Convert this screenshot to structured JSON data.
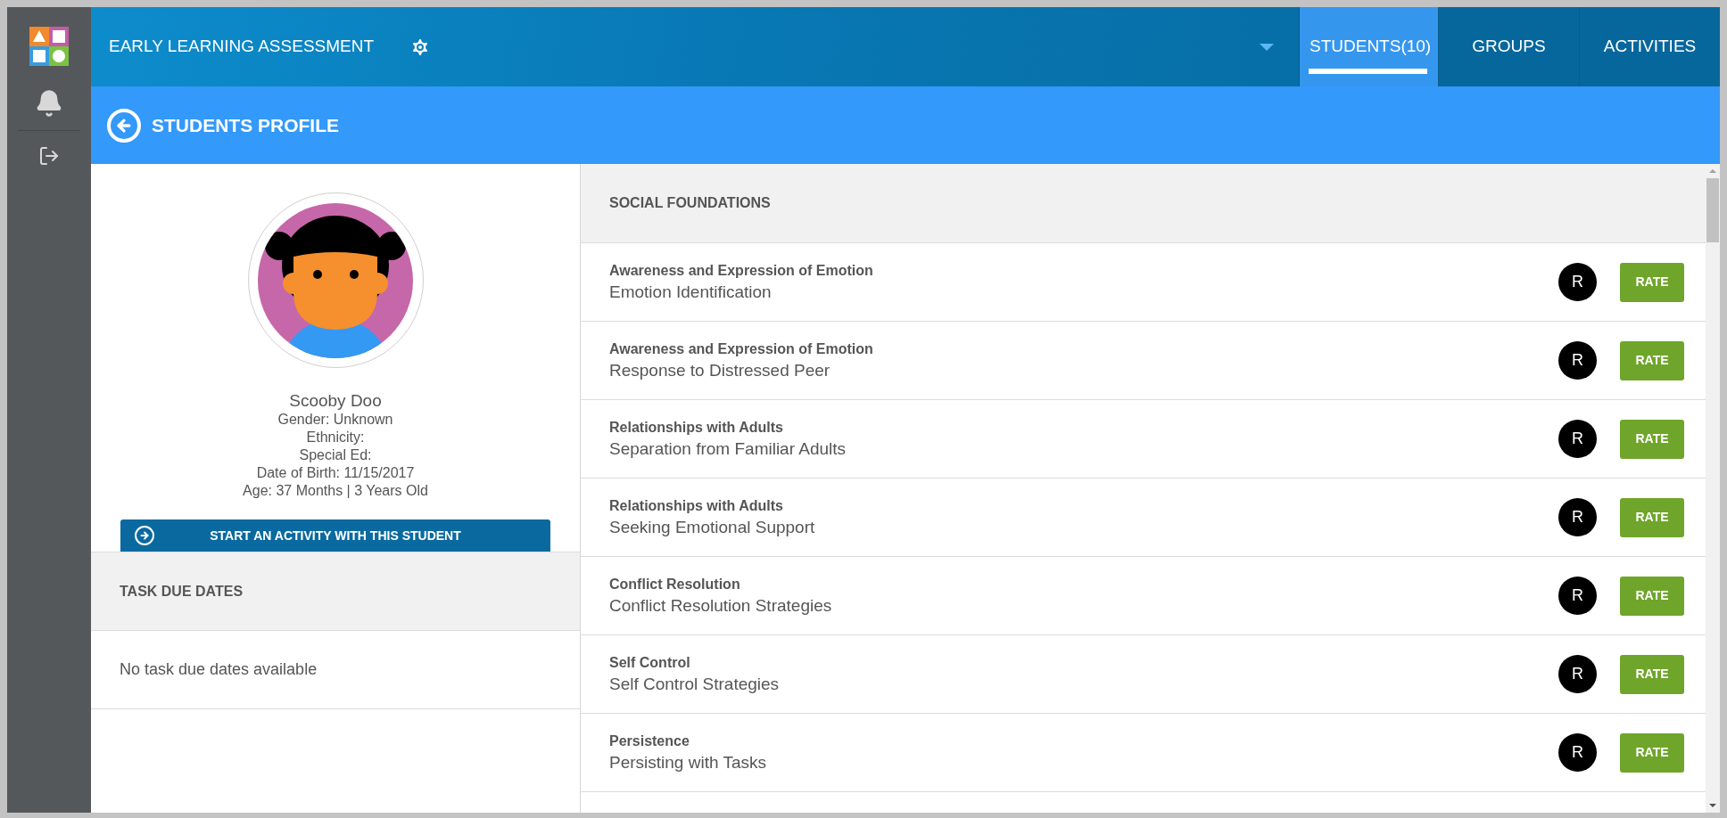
{
  "header": {
    "title": "EARLY LEARNING ASSESSMENT",
    "tabs": [
      {
        "label": "STUDENTS(10)",
        "selected": true
      },
      {
        "label": "GROUPS",
        "selected": false
      },
      {
        "label": "ACTIVITIES",
        "selected": false
      }
    ]
  },
  "page_header": {
    "title": "STUDENTS PROFILE"
  },
  "profile": {
    "name": "Scooby Doo",
    "details": [
      "Gender: Unknown",
      "Ethnicity:",
      "Special Ed:",
      "Date of Birth: 11/15/2017",
      "Age: 37 Months | 3 Years Old"
    ],
    "action_button": "START AN ACTIVITY WITH THIS STUDENT"
  },
  "task_due_dates": {
    "title": "TASK DUE DATES",
    "empty_message": "No task due dates available"
  },
  "section": {
    "title": "SOCIAL FOUNDATIONS",
    "rows": [
      {
        "category": "Awareness and Expression of Emotion",
        "skill": "Emotion Identification",
        "badge": "R",
        "button": "RATE"
      },
      {
        "category": "Awareness and Expression of Emotion",
        "skill": "Response to Distressed Peer",
        "badge": "R",
        "button": "RATE"
      },
      {
        "category": "Relationships with Adults",
        "skill": "Separation from Familiar Adults",
        "badge": "R",
        "button": "RATE"
      },
      {
        "category": "Relationships with Adults",
        "skill": "Seeking Emotional Support",
        "badge": "R",
        "button": "RATE"
      },
      {
        "category": "Conflict Resolution",
        "skill": "Conflict Resolution Strategies",
        "badge": "R",
        "button": "RATE"
      },
      {
        "category": "Self Control",
        "skill": "Self Control Strategies",
        "badge": "R",
        "button": "RATE"
      },
      {
        "category": "Persistence",
        "skill": "Persisting with Tasks",
        "badge": "R",
        "button": "RATE"
      }
    ]
  }
}
